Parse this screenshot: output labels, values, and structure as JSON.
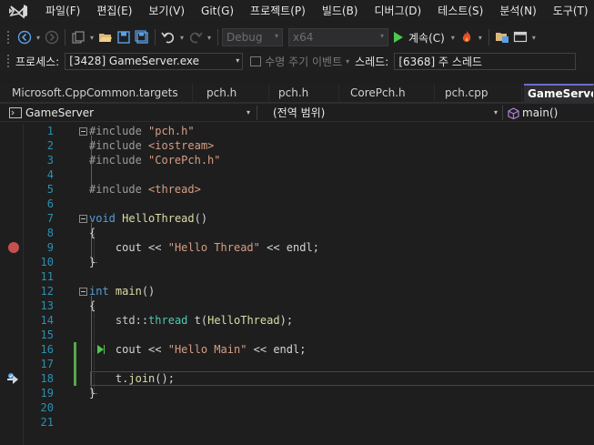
{
  "menu": [
    "파일(F)",
    "편집(E)",
    "보기(V)",
    "Git(G)",
    "프로젝트(P)",
    "빌드(B)",
    "디버그(D)",
    "테스트(S)",
    "분석(N)",
    "도구(T)"
  ],
  "toolbar": {
    "config": "Debug",
    "platform": "x64",
    "continue_label": "계속(C)",
    "icons": [
      "back-icon",
      "forward-icon",
      "new-project-icon",
      "open-folder-icon",
      "save-icon",
      "save-all-icon",
      "undo-icon",
      "redo-icon",
      "hot-reload-icon",
      "solution-explorer-icon",
      "window-layout-icon"
    ]
  },
  "debug_location": {
    "process_label": "프로세스:",
    "process_value": "[3428] GameServer.exe",
    "lifecycle_label": "수명 주기 이벤트",
    "thread_label": "스레드:",
    "thread_value": "[6368] 주 스레드"
  },
  "tabs": [
    "Microsoft.CppCommon.targets",
    "pch.h",
    "pch.h",
    "CorePch.h",
    "pch.cpp",
    "GameServer.cpp"
  ],
  "active_tab_index": 5,
  "navbar": {
    "project": "GameServer",
    "scope": "(전역 범위)",
    "member": "main()"
  },
  "code_lines": [
    {
      "n": "1",
      "text": "#include \"pch.h\""
    },
    {
      "n": "2",
      "text": "#include <iostream>"
    },
    {
      "n": "3",
      "text": "#include \"CorePch.h\""
    },
    {
      "n": "4",
      "text": ""
    },
    {
      "n": "5",
      "text": "#include <thread>"
    },
    {
      "n": "6",
      "text": ""
    },
    {
      "n": "7",
      "text": "void HelloThread()"
    },
    {
      "n": "8",
      "text": "{"
    },
    {
      "n": "9",
      "text": "    cout << \"Hello Thread\" << endl;"
    },
    {
      "n": "10",
      "text": "}"
    },
    {
      "n": "11",
      "text": ""
    },
    {
      "n": "12",
      "text": "int main()"
    },
    {
      "n": "13",
      "text": "{"
    },
    {
      "n": "14",
      "text": "    std::thread t(HelloThread);"
    },
    {
      "n": "15",
      "text": ""
    },
    {
      "n": "16",
      "text": "    cout << \"Hello Main\" << endl;"
    },
    {
      "n": "17",
      "text": ""
    },
    {
      "n": "18",
      "text": "    t.join();"
    },
    {
      "n": "19",
      "text": "}"
    },
    {
      "n": "20",
      "text": ""
    },
    {
      "n": "21",
      "text": ""
    }
  ],
  "breakpoint_line": "9",
  "current_statement_line": "16",
  "changed_lines": [
    "16",
    "17",
    "18"
  ],
  "colors": {
    "keyword": "#569cd6",
    "preprocessor": "#9b9b9b",
    "string": "#d69d85",
    "function": "#dcdcaa",
    "type": "#4ec9b0",
    "line_number": "#2b91af",
    "breakpoint": "#c74f50",
    "change_bar": "#57a64a",
    "active_tab_accent": "#6d6dcf"
  }
}
